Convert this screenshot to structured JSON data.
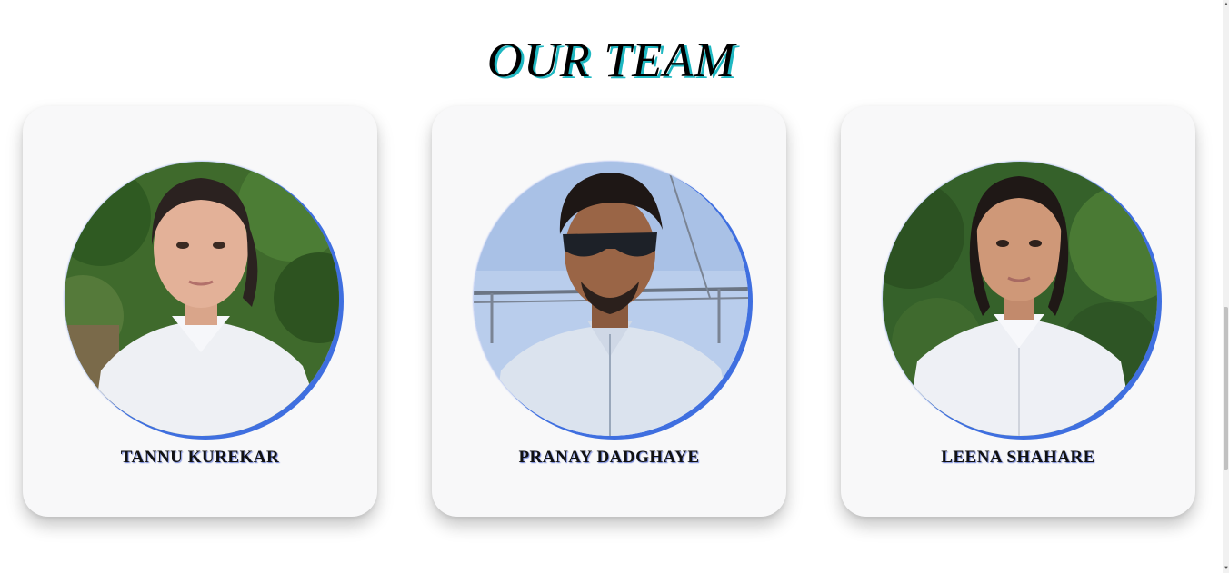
{
  "section": {
    "title": "OUR TEAM"
  },
  "team": [
    {
      "name": "TANNU KUREKAR",
      "photo_icon": "person-photo"
    },
    {
      "name": "PRANAY DADGHAYE",
      "photo_icon": "person-photo"
    },
    {
      "name": "LEENA SHAHARE",
      "photo_icon": "person-photo"
    }
  ],
  "colors": {
    "title_shadow": "#1fb8c2",
    "photo_ring": "#3f6fe0",
    "card_bg": "#f8f8f9",
    "name_shadow": "#6a7fd8"
  }
}
